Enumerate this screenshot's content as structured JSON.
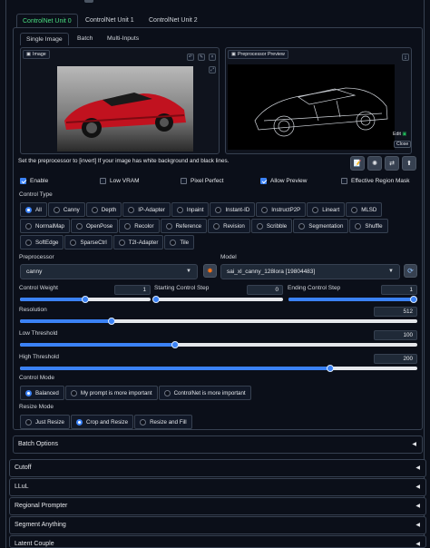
{
  "tabs": [
    "ControlNet Unit 0",
    "ControlNet Unit 1",
    "ControlNet Unit 2"
  ],
  "subtabs": [
    "Single Image",
    "Batch",
    "Multi-Inputs"
  ],
  "image_panel": {
    "label": "Image"
  },
  "preview_panel": {
    "label": "Preprocessor Preview",
    "edit_label": "Edit",
    "close_label": "Close"
  },
  "hint": "Set the preprocessor to [invert] If your image has white background and black lines.",
  "checkboxes": [
    {
      "label": "Enable",
      "checked": true
    },
    {
      "label": "Low VRAM",
      "checked": false
    },
    {
      "label": "Pixel Perfect",
      "checked": false
    },
    {
      "label": "Allow Preview",
      "checked": true
    },
    {
      "label": "Effective Region Mask",
      "checked": false
    }
  ],
  "control_type": {
    "label": "Control Type",
    "row1": [
      "All",
      "Canny",
      "Depth",
      "IP-Adapter",
      "Inpaint",
      "Instant-ID",
      "InstructP2P",
      "Lineart",
      "MLSD"
    ],
    "row2": [
      "NormalMap",
      "OpenPose",
      "Recolor",
      "Reference",
      "Revision",
      "Scribble",
      "Segmentation",
      "Shuffle"
    ],
    "row3": [
      "SoftEdge",
      "SparseCtrl",
      "T2I-Adapter",
      "Tile"
    ],
    "selected": "All"
  },
  "preprocessor": {
    "label": "Preprocessor",
    "value": "canny"
  },
  "model": {
    "label": "Model",
    "value": "sai_xl_canny_128lora [19804483]"
  },
  "sliders": {
    "control_weight": {
      "label": "Control Weight",
      "value": "1",
      "fraction": 0.5
    },
    "starting_step": {
      "label": "Starting Control Step",
      "value": "0",
      "fraction": 0.0
    },
    "ending_step": {
      "label": "Ending Control Step",
      "value": "1",
      "fraction": 1.0
    },
    "resolution": {
      "label": "Resolution",
      "value": "512",
      "fraction": 0.23
    },
    "low_threshold": {
      "label": "Low Threshold",
      "value": "100",
      "fraction": 0.39
    },
    "high_threshold": {
      "label": "High Threshold",
      "value": "200",
      "fraction": 0.78
    }
  },
  "control_mode": {
    "label": "Control Mode",
    "options": [
      "Balanced",
      "My prompt is more important",
      "ControlNet is more important"
    ],
    "selected": "Balanced"
  },
  "resize_mode": {
    "label": "Resize Mode",
    "options": [
      "Just Resize",
      "Crop and Resize",
      "Resize and Fill"
    ],
    "selected": "Crop and Resize"
  },
  "accordions": [
    "Batch Options",
    "Cutoff",
    "LLuL",
    "Regional Prompter",
    "Segment Anything",
    "Latent Couple"
  ],
  "colors": {
    "accent": "#3b82f6",
    "active_tab": "#4ade80",
    "background": "#0b0f19"
  }
}
